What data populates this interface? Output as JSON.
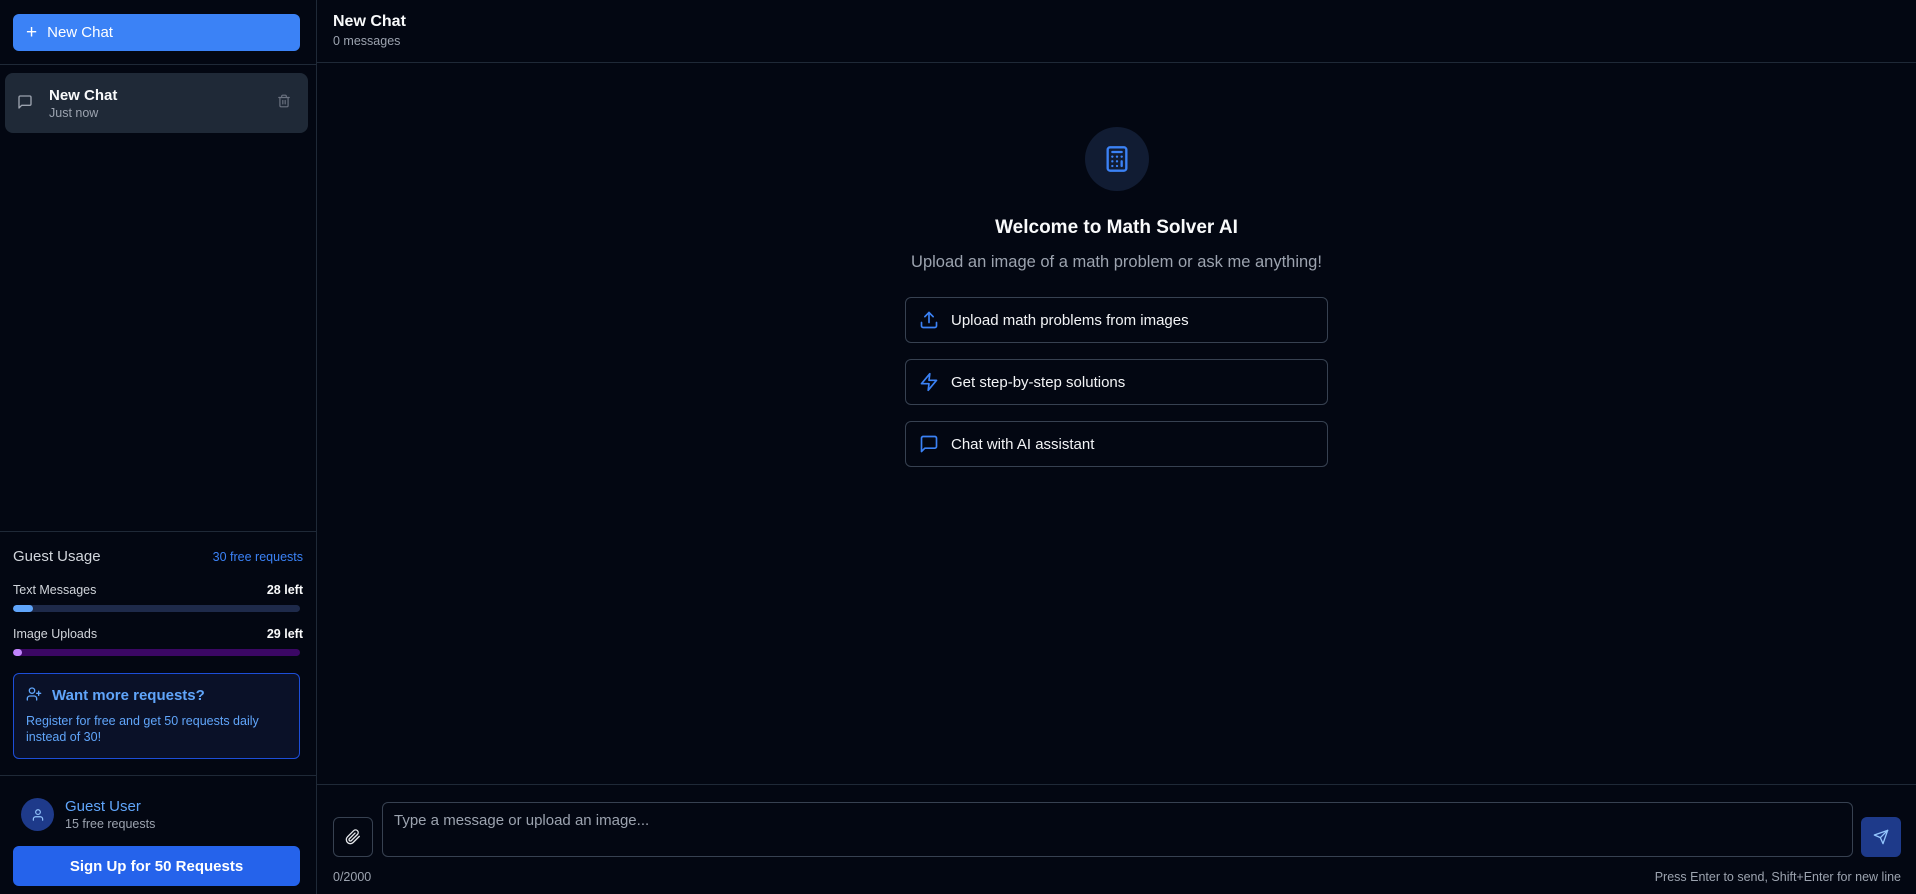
{
  "sidebar": {
    "new_chat_label": "New Chat",
    "chats": [
      {
        "title": "New Chat",
        "time": "Just now"
      }
    ],
    "usage": {
      "title": "Guest Usage",
      "free_requests": "30 free requests",
      "text_messages": {
        "label": "Text Messages",
        "left": "28 left",
        "fraction": 0.07
      },
      "image_uploads": {
        "label": "Image Uploads",
        "left": "29 left",
        "fraction": 0.03
      }
    },
    "promo": {
      "title": "Want more requests?",
      "text": "Register for free and get 50 requests daily instead of 30!"
    },
    "user": {
      "name": "Guest User",
      "sub": "15 free requests"
    },
    "signup_label": "Sign Up for 50 Requests"
  },
  "header": {
    "title": "New Chat",
    "subtitle": "0 messages"
  },
  "welcome": {
    "icon": "calculator-icon",
    "title": "Welcome to Math Solver AI",
    "subtitle": "Upload an image of a math problem or ask me anything!",
    "features": [
      {
        "icon": "upload-icon",
        "label": "Upload math problems from images"
      },
      {
        "icon": "zap-icon",
        "label": "Get step-by-step solutions"
      },
      {
        "icon": "message-icon",
        "label": "Chat with AI assistant"
      }
    ]
  },
  "composer": {
    "placeholder": "Type a message or upload an image...",
    "counter": "0/2000",
    "hint": "Press Enter to send, Shift+Enter for new line"
  },
  "colors": {
    "background": "#030712",
    "accent": "#3b82f6",
    "purple": "#c084fc"
  }
}
